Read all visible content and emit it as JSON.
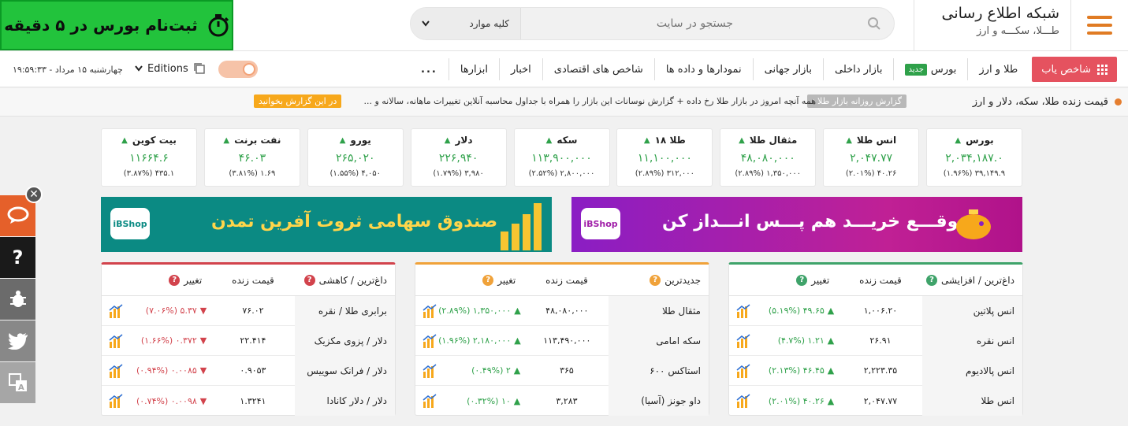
{
  "header": {
    "promo_text": "ثبت‌نام بورس در ۵ دقیقه",
    "site_name": "شبکه اطلاع رسانی",
    "site_tagline": "طـــلا، سکـــه و ارز",
    "search_placeholder": "جستجو در سایت",
    "search_scope": "کلیه موارد"
  },
  "nav": {
    "index_finder": "شاخص یاب",
    "items": [
      "طلا و ارز",
      "بورس",
      "بازار داخلی",
      "بازار جهانی",
      "نمودارها و داده ها",
      "شاخص های اقتصادی",
      "اخبار",
      "ابزارها",
      "..."
    ],
    "new_badge": "جدید",
    "editions": "Editions",
    "datetime": "چهارشنبه ۱۵ مرداد - ۱۹:۵۹:۳۳"
  },
  "ticker": {
    "live_label": "قیمت زنده طلا، سکه، دلار و ارز",
    "report_tag": "گزارش روزانه بازار طلا :",
    "report_text": "همه آنچه امروز در بازار طلا رخ داده + گزارش نوسانات این بازار را همراه با جداول محاسبه آنلاین تغییرات ماهانه، سالانه و ...",
    "report_link": "در این گزارش بخوانید"
  },
  "cards": [
    {
      "title": "بورس",
      "value": "۲,۰۳۴,۱۸۷.۰",
      "change": "۳۹,۱۴۹.۹ (۱.۹۶%)"
    },
    {
      "title": "انس طلا",
      "value": "۲,۰۴۷.۷۷",
      "change": "۴۰.۲۶ (۲.۰۱%)"
    },
    {
      "title": "مثقال طلا",
      "value": "۴۸,۰۸۰,۰۰۰",
      "change": "۱,۳۵۰,۰۰۰ (۲.۸۹%)"
    },
    {
      "title": "طلا ۱۸",
      "value": "۱۱,۱۰۰,۰۰۰",
      "change": "۳۱۲,۰۰۰ (۲.۸۹%)"
    },
    {
      "title": "سکه",
      "value": "۱۱۳,۹۰۰,۰۰۰",
      "change": "۲,۸۰۰,۰۰۰ (۲.۵۲%)"
    },
    {
      "title": "دلار",
      "value": "۲۲۶,۹۴۰",
      "change": "۳,۹۸۰ (۱.۷۹%)"
    },
    {
      "title": "یورو",
      "value": "۲۶۵,۰۲۰",
      "change": "۴,۰۵۰ (۱.۵۵%)"
    },
    {
      "title": "نفت برنت",
      "value": "۴۶.۰۳",
      "change": "۱.۶۹ (۳.۸۱%)"
    },
    {
      "title": "بیت کوین",
      "value": "۱۱۶۶۴.۶",
      "change": "۴۳۵.۱ (۳.۸۷%)"
    }
  ],
  "banners": {
    "left_text": "صندوق سهامی ثروت آفرین تمدن",
    "right_text": "موقـــع خریـــد هم پـــس انـــداز کن",
    "brand": "iBShop"
  },
  "tables": [
    {
      "id": "gainers",
      "h_name": "داغ‌ترین / افزایشی",
      "h_price": "قیمت زنده",
      "h_change": "تغییر",
      "rows": [
        {
          "name": "انس پلاتین",
          "price": "۱,۰۰۶.۲۰",
          "change": "۴۹.۶۵ (۵.۱۹%)"
        },
        {
          "name": "انس نقره",
          "price": "۲۶.۹۱",
          "change": "۱.۲۱ (۴.۷%)"
        },
        {
          "name": "انس پالادیوم",
          "price": "۲,۲۲۳.۳۵",
          "change": "۴۶.۴۵ (۲.۱۳%)"
        },
        {
          "name": "انس طلا",
          "price": "۲,۰۴۷.۷۷",
          "change": "۴۰.۲۶ (۲.۰۱%)"
        }
      ]
    },
    {
      "id": "newest",
      "h_name": "جدیدترین",
      "h_price": "قیمت زنده",
      "h_change": "تغییر",
      "rows": [
        {
          "name": "مثقال طلا",
          "price": "۴۸,۰۸۰,۰۰۰",
          "change": "۱,۳۵۰,۰۰۰ (۲.۸۹%)"
        },
        {
          "name": "سکه امامی",
          "price": "۱۱۳,۴۹۰,۰۰۰",
          "change": "۲,۱۸۰,۰۰۰ (۱.۹۶%)"
        },
        {
          "name": "استاکس ۶۰۰",
          "price": "۳۶۵",
          "change": "۲ (۰.۴۹%)"
        },
        {
          "name": "داو جونز (آسیا)",
          "price": "۳,۲۸۳",
          "change": "۱۰ (۰.۳۲%)"
        }
      ]
    },
    {
      "id": "losers",
      "h_name": "داغ‌ترین / کاهشی",
      "h_price": "قیمت زنده",
      "h_change": "تغییر",
      "rows": [
        {
          "name": "برابری طلا / نقره",
          "price": "۷۶.۰۲",
          "change": "۵.۳۷ (۷.۰۶%)"
        },
        {
          "name": "دلار / پزوی مکزیک",
          "price": "۲۲.۴۱۴",
          "change": "۰.۳۷۲ (۱.۶۶%)"
        },
        {
          "name": "دلار / فرانک سوییس",
          "price": "۰.۹۰۵۳",
          "change": "۰.۰۰۸۵ (۰.۹۴%)"
        },
        {
          "name": "دلار / دلار کانادا",
          "price": "۱.۳۲۴۱",
          "change": "۰.۰۰۹۸ (۰.۷۴%)"
        }
      ]
    }
  ],
  "colors": {
    "green": "#2fa14a",
    "red": "#d2434c",
    "orange": "#e07b23",
    "sidebar": [
      "#e5602a",
      "#1a1a1a",
      "#6b6b6b",
      "#888888",
      "#a6a6a6"
    ]
  }
}
